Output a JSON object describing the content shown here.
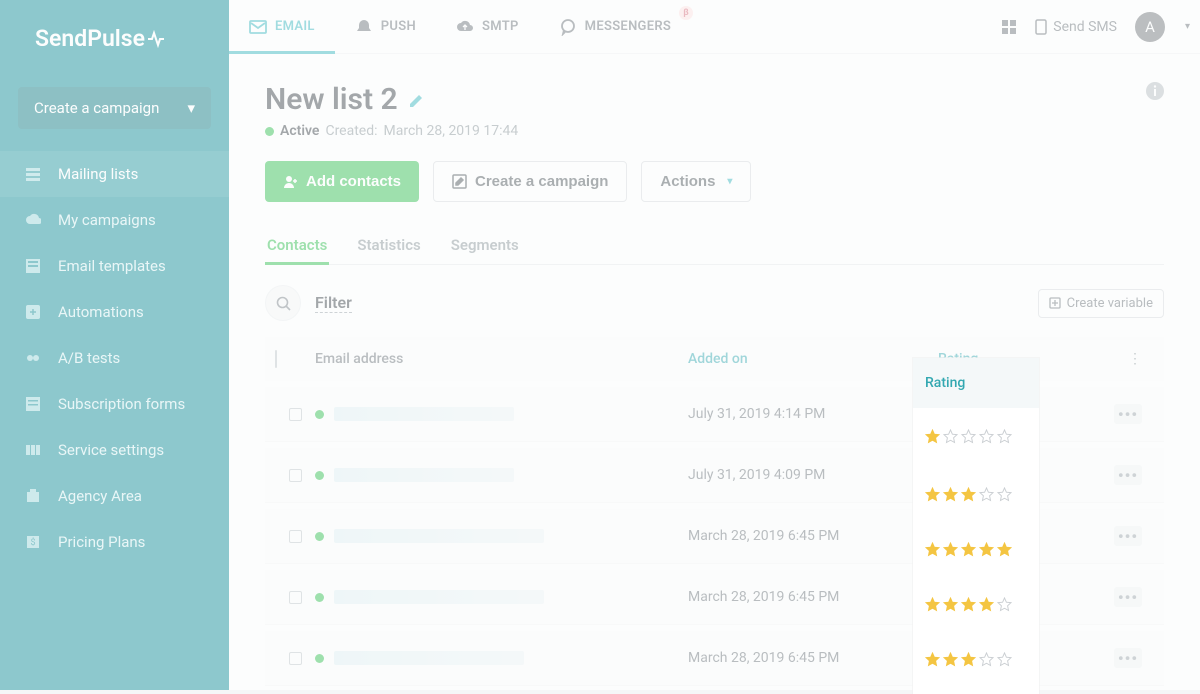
{
  "brand": "SendPulse",
  "sidebar": {
    "create_label": "Create a campaign",
    "items": [
      {
        "label": "Mailing lists",
        "icon": "list-icon"
      },
      {
        "label": "My campaigns",
        "icon": "cloud-icon"
      },
      {
        "label": "Email templates",
        "icon": "template-icon"
      },
      {
        "label": "Automations",
        "icon": "automation-icon"
      },
      {
        "label": "A/B tests",
        "icon": "ab-icon"
      },
      {
        "label": "Subscription forms",
        "icon": "form-icon"
      },
      {
        "label": "Service settings",
        "icon": "settings-icon"
      },
      {
        "label": "Agency Area",
        "icon": "agency-icon"
      },
      {
        "label": "Pricing Plans",
        "icon": "pricing-icon"
      }
    ]
  },
  "topnav": {
    "tabs": [
      {
        "label": "EMAIL",
        "icon": "mail-icon"
      },
      {
        "label": "PUSH",
        "icon": "bell-icon"
      },
      {
        "label": "SMTP",
        "icon": "cloud-up-icon"
      },
      {
        "label": "MESSENGERS",
        "icon": "chat-icon",
        "badge": "β"
      }
    ],
    "send_sms": "Send SMS",
    "avatar": "A"
  },
  "page": {
    "title": "New list 2",
    "status": "Active",
    "created_prefix": "Created:",
    "created": "March 28, 2019 17:44"
  },
  "actions": {
    "add_contacts": "Add contacts",
    "create_campaign": "Create a campaign",
    "actions": "Actions"
  },
  "tabs": [
    "Contacts",
    "Statistics",
    "Segments"
  ],
  "filter": {
    "label": "Filter",
    "create_variable": "Create variable"
  },
  "table": {
    "headers": {
      "email": "Email address",
      "added": "Added on",
      "rating": "Rating"
    },
    "rows": [
      {
        "added": "July 31, 2019 4:14 PM",
        "rating": 1,
        "blur_w": 180
      },
      {
        "added": "July 31, 2019 4:09 PM",
        "rating": 3,
        "blur_w": 180
      },
      {
        "added": "March 28, 2019 6:45 PM",
        "rating": 5,
        "blur_w": 210
      },
      {
        "added": "March 28, 2019 6:45 PM",
        "rating": 4,
        "blur_w": 210
      },
      {
        "added": "March 28, 2019 6:45 PM",
        "rating": 3,
        "blur_w": 190
      }
    ]
  }
}
